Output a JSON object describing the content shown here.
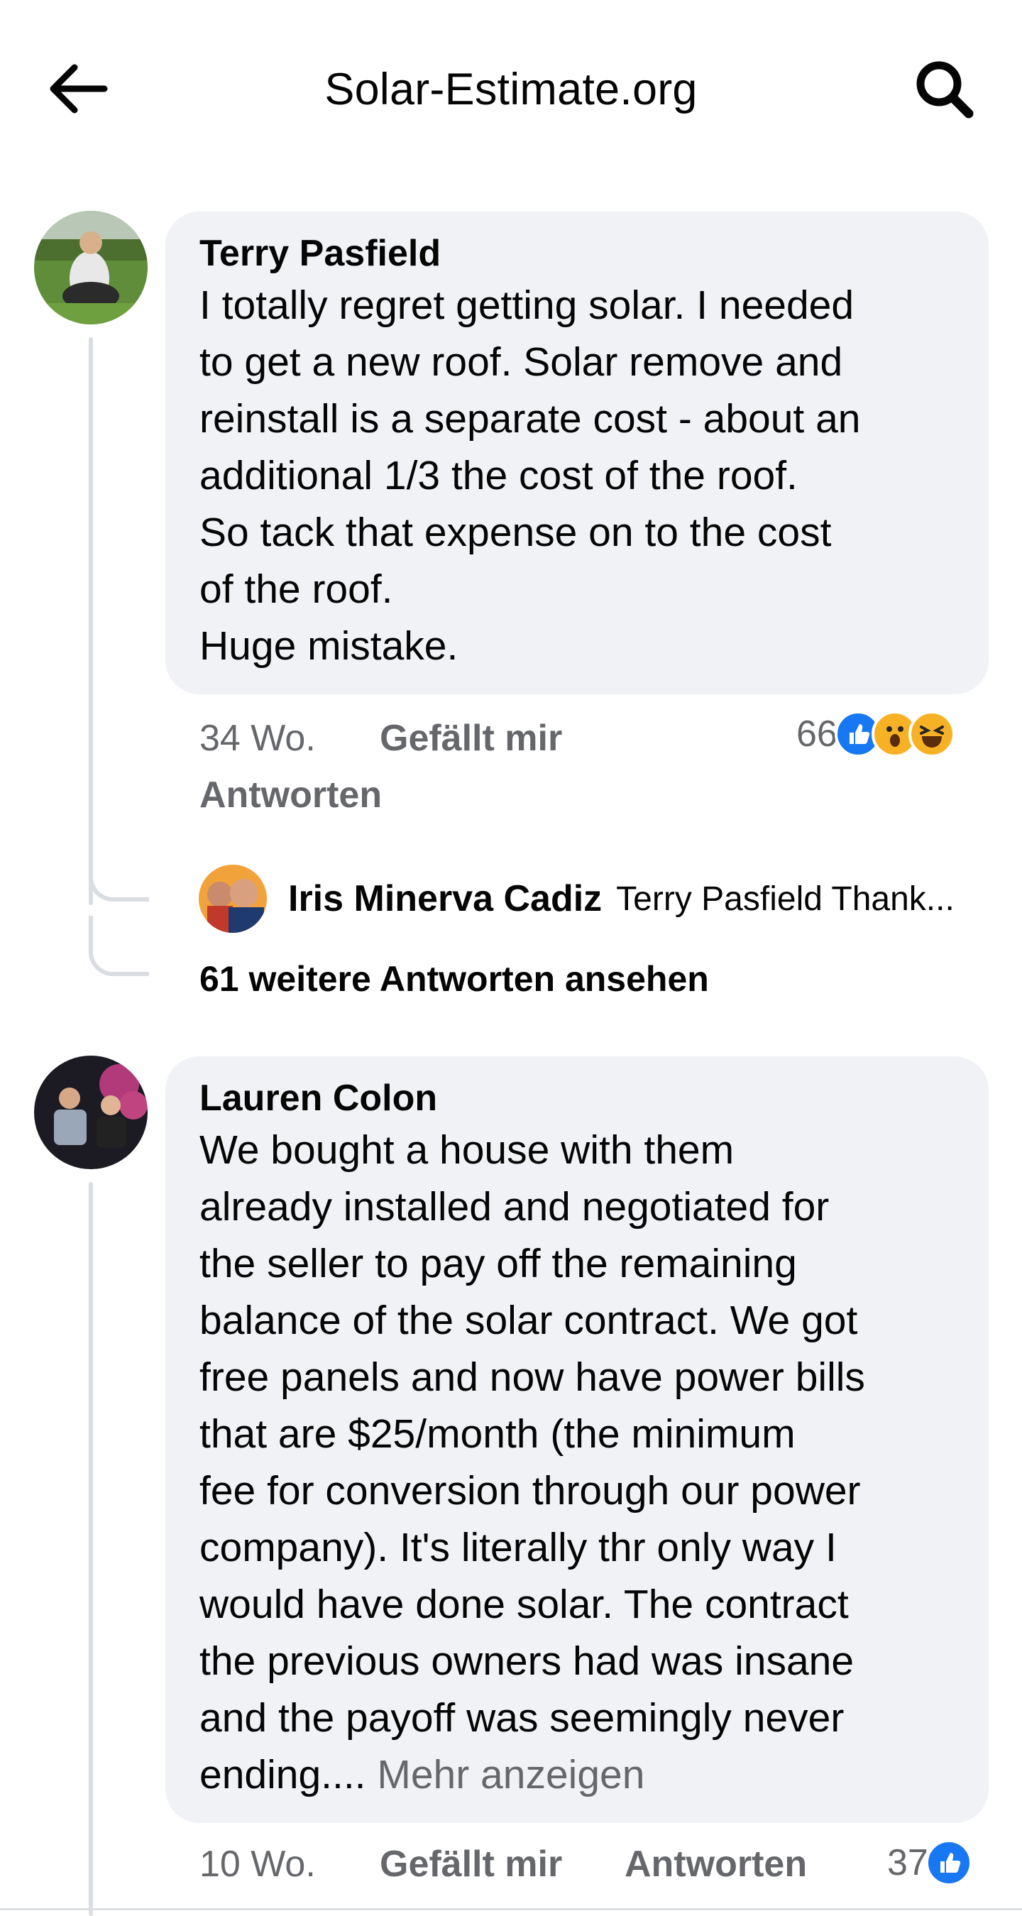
{
  "header": {
    "title": "Solar-Estimate.org"
  },
  "comments": [
    {
      "author": "Terry Pasfield",
      "text": "I totally regret getting solar. I needed\nto get a new roof. Solar remove and\nreinstall is a separate cost - about an\nadditional 1/3 the cost of the roof.\nSo tack that expense on to the cost\nof the roof.\nHuge mistake.",
      "time": "34 Wo.",
      "like_label": "Gefällt mir",
      "reply_label": "Antworten",
      "reaction_count": "66",
      "reactions": [
        "like",
        "wow",
        "haha"
      ],
      "reply_preview": {
        "author": "Iris Minerva Cadiz",
        "snippet": "Terry Pasfield Thank..."
      },
      "more_replies_label": "61 weitere Antworten ansehen"
    },
    {
      "author": "Lauren Colon",
      "text": "We bought a house with them\nalready installed and negotiated for\nthe seller to pay off the remaining\nbalance of the solar contract. We got\nfree panels and now have power bills\nthat are $25/month (the minimum\nfee for conversion through our power\ncompany). It's literally thr only way I\nwould have done solar. The contract\nthe previous owners had was insane\nand the payoff was seemingly never\nending.... ",
      "more_label": "Mehr anzeigen",
      "time": "10 Wo.",
      "like_label": "Gefällt mir",
      "reply_label": "Antworten",
      "reaction_count": "37",
      "reactions": [
        "like"
      ]
    }
  ],
  "colors": {
    "bubble": "#f0f2f5",
    "secondary_text": "#65676b",
    "like_blue": "#1877f2",
    "reaction_yellow": "#f7b125"
  }
}
